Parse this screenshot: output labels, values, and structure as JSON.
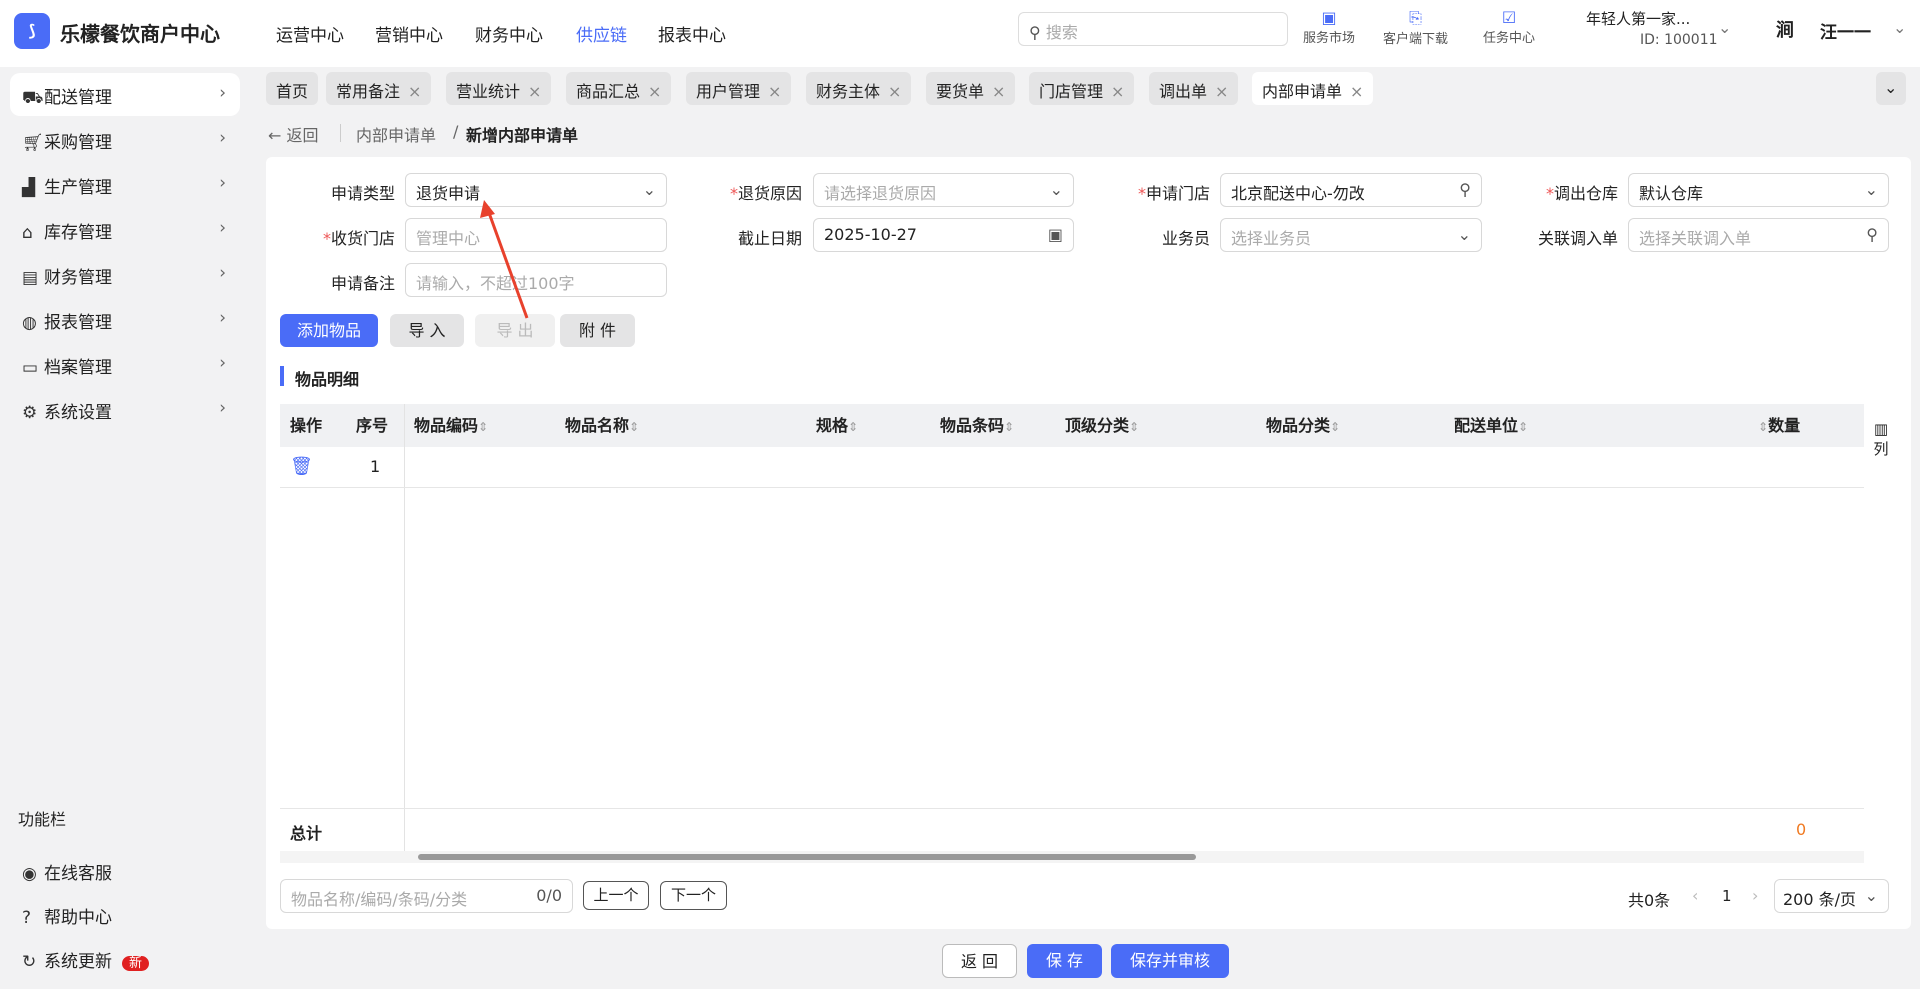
{
  "app": {
    "title": "乐檬餐饮商户中心",
    "logo_icon": "lemon-logo-icon"
  },
  "topnav": [
    "运营中心",
    "营销中心",
    "财务中心",
    "供应链",
    "报表中心"
  ],
  "topnav_active": "供应链",
  "search_placeholder": "搜索",
  "tools": [
    "服务市场",
    "客户端下载",
    "任务中心"
  ],
  "account": {
    "name": "年轻人第一家...",
    "id": "ID: 100011",
    "user": "汪一一"
  },
  "sidebar": {
    "items": [
      "配送管理",
      "采购管理",
      "生产管理",
      "库存管理",
      "财务管理",
      "报表管理",
      "档案管理",
      "系统设置"
    ],
    "section": "功能栏",
    "bottom": [
      "在线客服",
      "帮助中心",
      "系统更新"
    ],
    "badge": "新"
  },
  "tabs": [
    "首页",
    "常用备注",
    "营业统计",
    "商品汇总",
    "用户管理",
    "财务主体",
    "要货单",
    "门店管理",
    "调出单",
    "内部申请单"
  ],
  "breadcrumb": {
    "back": "返回",
    "parent": "内部申请单",
    "current": "新增内部申请单"
  },
  "form": {
    "apply_type": {
      "label": "申请类型",
      "value": "退货申请"
    },
    "return_reason": {
      "label": "退货原因",
      "placeholder": "请选择退货原因"
    },
    "apply_store": {
      "label": "申请门店",
      "value": "北京配送中心-勿改"
    },
    "out_warehouse": {
      "label": "调出仓库",
      "value": "默认仓库"
    },
    "receive_store": {
      "label": "收货门店",
      "placeholder": "管理中心"
    },
    "deadline": {
      "label": "截止日期",
      "value": "2025-10-27"
    },
    "salesman": {
      "label": "业务员",
      "placeholder": "选择业务员"
    },
    "related_in": {
      "label": "关联调入单",
      "placeholder": "选择关联调入单"
    },
    "remark": {
      "label": "申请备注",
      "placeholder": "请输入，不超过100字"
    }
  },
  "actions": {
    "add": "添加物品",
    "import": "导 入",
    "export": "导 出",
    "attach": "附 件"
  },
  "section_title": "物品明细",
  "table": {
    "columns": [
      "操作",
      "序号",
      "物品编码",
      "物品名称",
      "规格",
      "物品条码",
      "顶级分类",
      "物品分类",
      "配送单位",
      "数量"
    ],
    "rows": [
      {
        "index": "1"
      }
    ],
    "total_label": "总计",
    "total_qty": "0",
    "columns_btn": "列"
  },
  "finder": {
    "placeholder": "物品名称/编码/条码/分类",
    "count": "0/0",
    "prev": "上一个",
    "next": "下一个"
  },
  "pager": {
    "total": "共0条",
    "page": "1",
    "size": "200 条/页"
  },
  "footer": {
    "back": "返 回",
    "save": "保 存",
    "save_audit": "保存并审核"
  },
  "colors": {
    "accent": "#4a6cf7",
    "required": "#e55555",
    "annotation": "#e8412c"
  }
}
